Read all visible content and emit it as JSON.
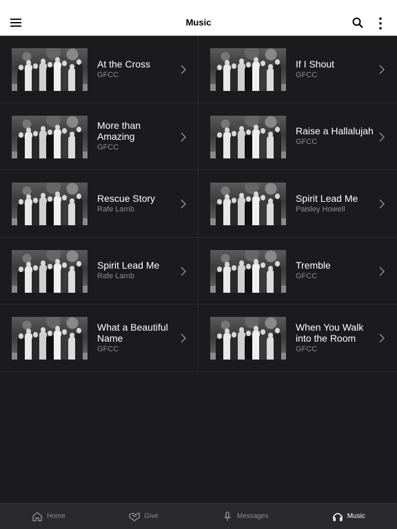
{
  "header": {
    "title": "Music"
  },
  "songs": [
    {
      "title": "At the Cross",
      "artist": "GFCC"
    },
    {
      "title": "If I Shout",
      "artist": "GFCC"
    },
    {
      "title": "More than Amazing",
      "artist": "GFCC"
    },
    {
      "title": "Raise a Hallalujah",
      "artist": "GFCC"
    },
    {
      "title": "Rescue Story",
      "artist": "Rafe Lamb"
    },
    {
      "title": "Spirit Lead Me",
      "artist": "Paisley Howell"
    },
    {
      "title": "Spirit Lead Me",
      "artist": "Rafe Lamb"
    },
    {
      "title": "Tremble",
      "artist": "GFCC"
    },
    {
      "title": "What a Beautiful Name",
      "artist": "GFCC"
    },
    {
      "title": "When You Walk into the Room",
      "artist": "GFCC"
    }
  ],
  "tabs": [
    {
      "label": "Home",
      "icon": "home-icon",
      "active": false
    },
    {
      "label": "Give",
      "icon": "give-icon",
      "active": false
    },
    {
      "label": "Messages",
      "icon": "microphone-icon",
      "active": false
    },
    {
      "label": "Music",
      "icon": "headphones-icon",
      "active": true
    }
  ],
  "colors": {
    "background": "#1b1b1d",
    "header": "#ffffff",
    "tabbar": "#2a2a2c",
    "subtitle": "#8e8e93"
  }
}
